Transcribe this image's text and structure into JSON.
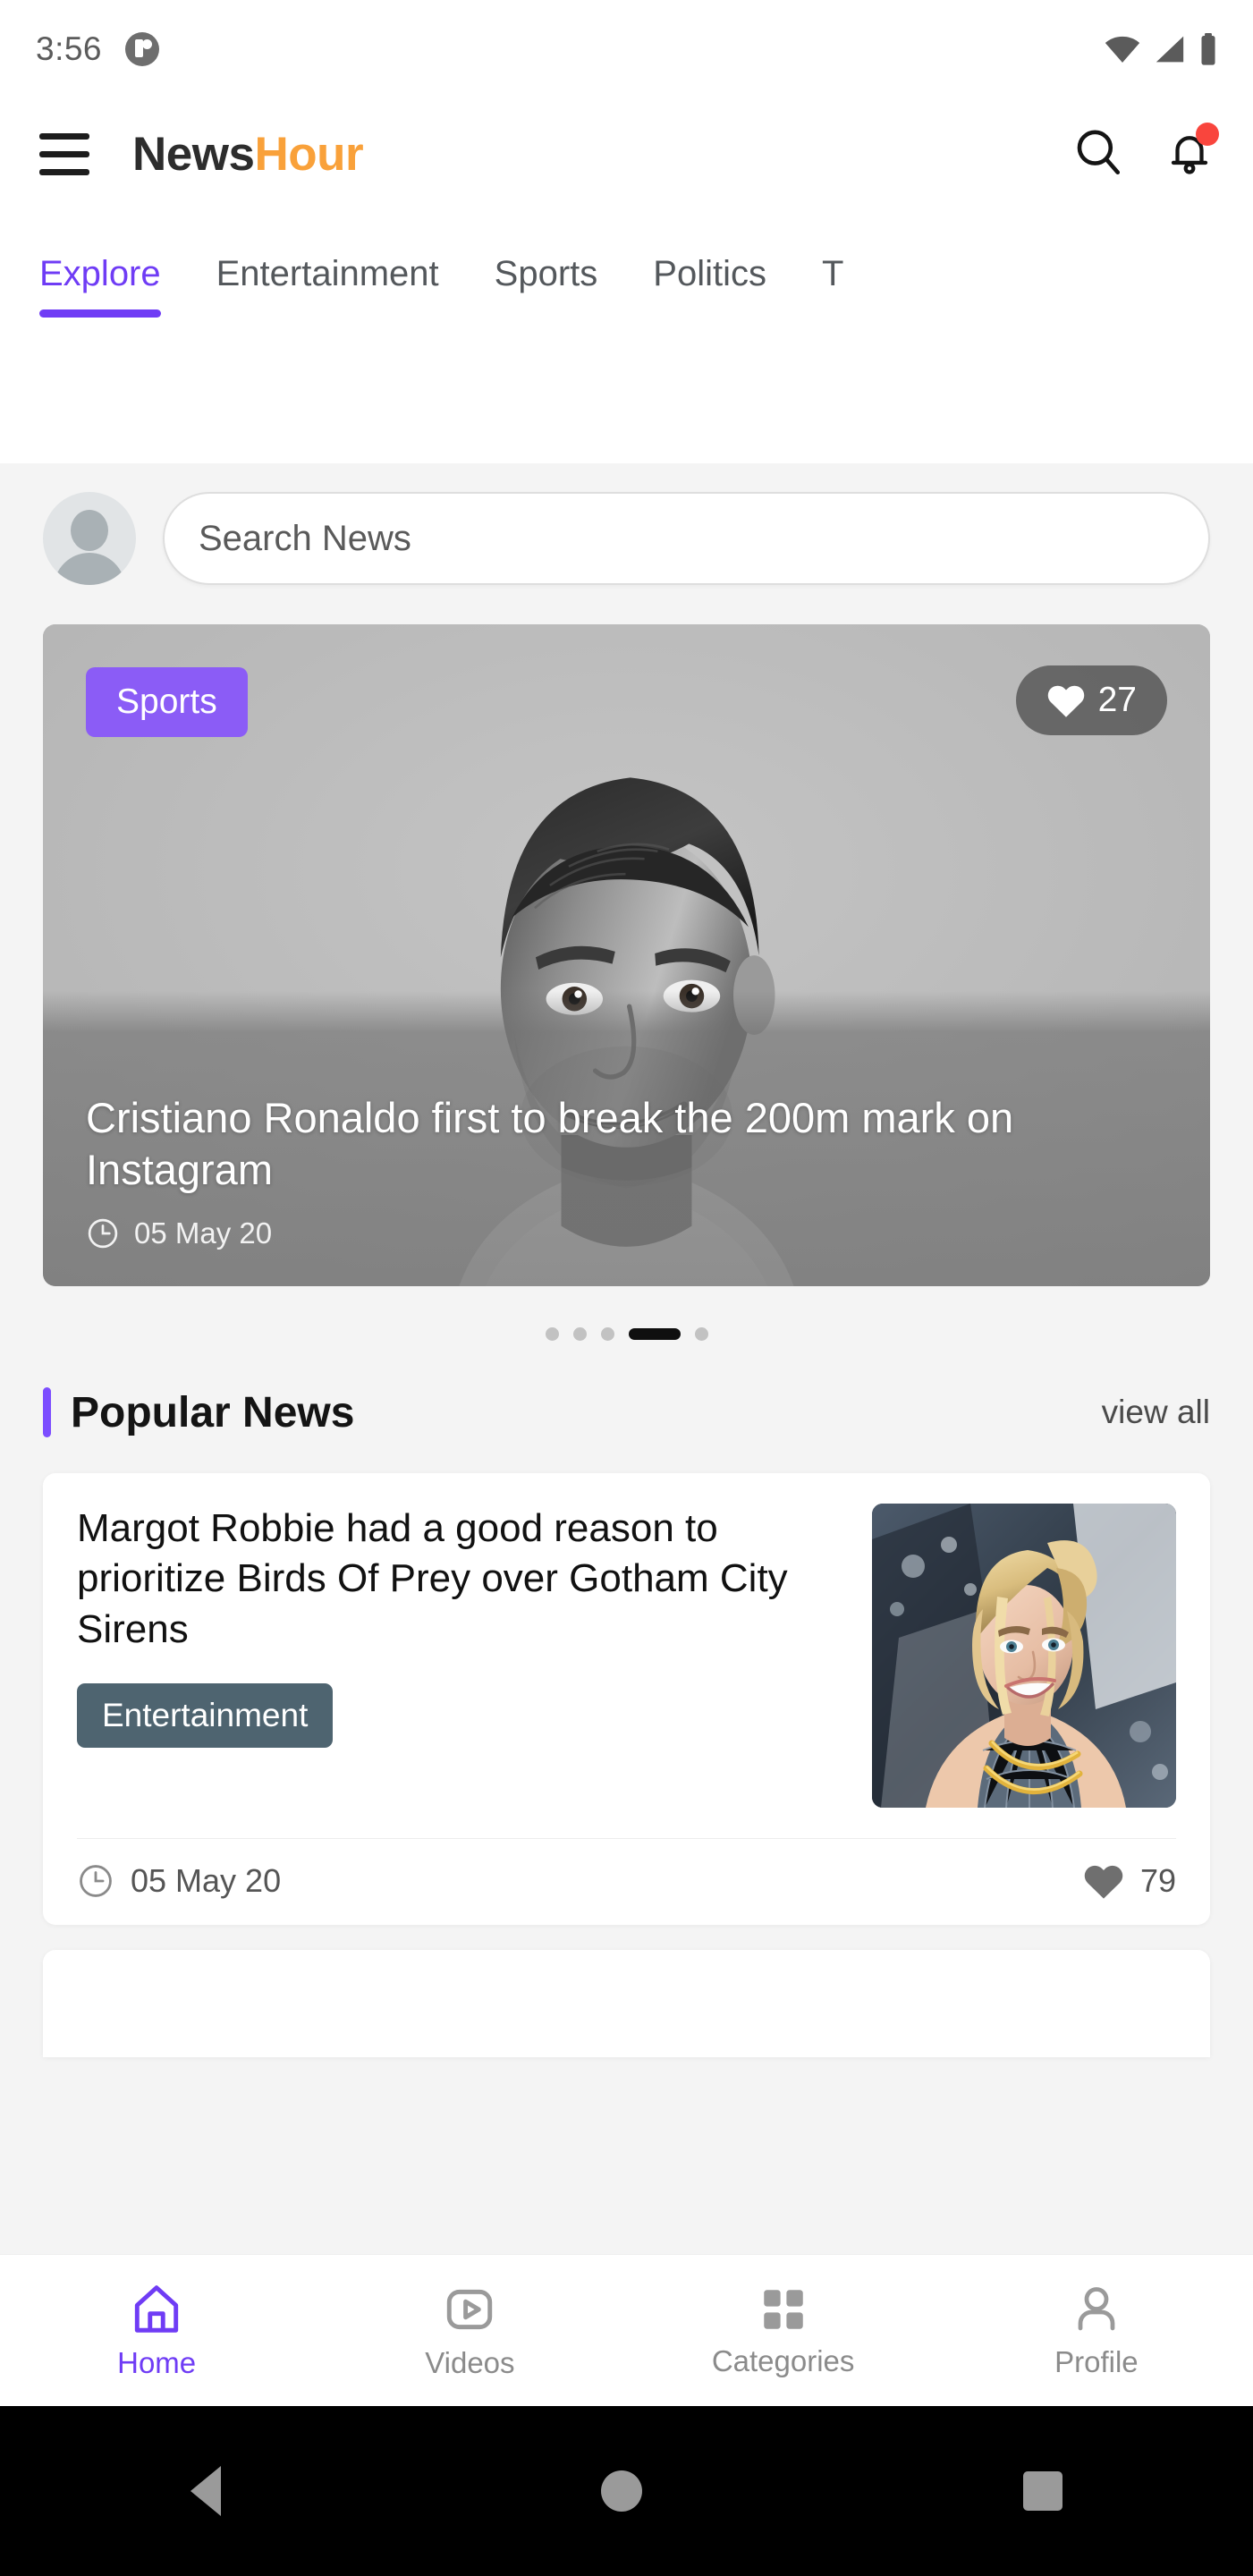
{
  "status_bar": {
    "time": "3:56",
    "app_icon": "clock-app-icon",
    "wifi_icon": "wifi-icon",
    "signal_icon": "cellular-signal-icon",
    "battery_icon": "battery-full-icon"
  },
  "app_bar": {
    "menu_icon": "hamburger-menu-icon",
    "brand_part1": "News",
    "brand_part2": "Hour",
    "search_icon": "search-icon",
    "notifications_icon": "bell-icon",
    "notification_badge_color": "#f9453d"
  },
  "tabs": {
    "items": [
      {
        "label": "Explore",
        "active": true
      },
      {
        "label": "Entertainment",
        "active": false
      },
      {
        "label": "Sports",
        "active": false
      },
      {
        "label": "Politics",
        "active": false
      },
      {
        "label": "T",
        "active": false
      }
    ],
    "active_color": "#6f3cf5"
  },
  "search": {
    "placeholder": "Search News",
    "value": "",
    "avatar_icon": "user-avatar-placeholder-icon"
  },
  "hero": {
    "category": "Sports",
    "category_color": "#8b5cf6",
    "likes": "27",
    "heart_icon": "heart-filled-icon",
    "title": "Cristiano Ronaldo first to break the 200m mark on Instagram",
    "clock_icon": "clock-icon",
    "date": "05 May 20"
  },
  "carousel": {
    "total": 5,
    "active_index": 3
  },
  "section": {
    "title": "Popular News",
    "view_all": "view all",
    "accent_color": "#7c4dff"
  },
  "popular_news": [
    {
      "title": "Margot Robbie had a good reason to prioritize Birds Of Prey over Gotham City Sirens",
      "category": "Entertainment",
      "category_color": "#4e6470",
      "clock_icon": "clock-icon",
      "date": "05 May 20",
      "heart_icon": "heart-filled-icon",
      "likes": "79",
      "thumbnail_icon": "article-thumbnail-image"
    }
  ],
  "bottom_nav": {
    "items": [
      {
        "label": "Home",
        "icon": "home-icon",
        "active": true
      },
      {
        "label": "Videos",
        "icon": "video-play-icon",
        "active": false
      },
      {
        "label": "Categories",
        "icon": "grid-icon",
        "active": false
      },
      {
        "label": "Profile",
        "icon": "person-icon",
        "active": false
      }
    ],
    "active_color": "#6f3cf5"
  },
  "android_nav": {
    "back_icon": "android-back-icon",
    "home_icon": "android-home-icon",
    "recents_icon": "android-recents-icon"
  }
}
